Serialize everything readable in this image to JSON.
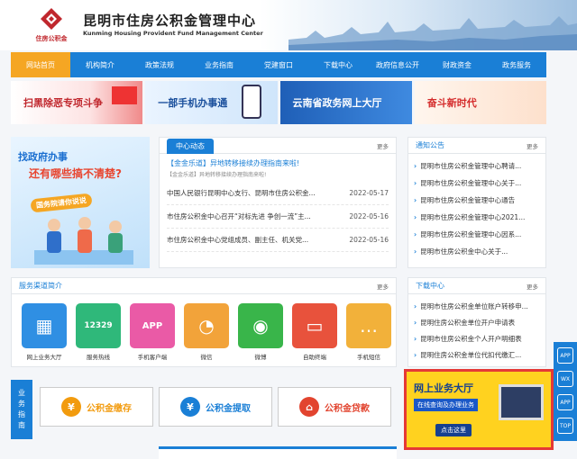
{
  "header": {
    "logo_text": "住房公积金",
    "title": "昆明市住房公积金管理中心",
    "subtitle": "Kunming Housing Provident Fund Management Center"
  },
  "nav": [
    {
      "label": "网站首页",
      "active": true
    },
    {
      "label": "机构简介"
    },
    {
      "label": "政策法规"
    },
    {
      "label": "业务指南"
    },
    {
      "label": "党建窗口"
    },
    {
      "label": "下载中心"
    },
    {
      "label": "政府信息公开"
    },
    {
      "label": "财政资金"
    },
    {
      "label": "政务服务"
    }
  ],
  "banners": [
    "扫黑除恶专项斗争",
    "一部手机办事通",
    "云南省政务网上大厅",
    "奋斗新时代"
  ],
  "promo": {
    "line1": "找政府办事",
    "line2": "还有哪些搞不清楚?",
    "line3": "国务院请你说说"
  },
  "news": {
    "tab": "中心动态",
    "more": "更多",
    "headline": "【金金乐道】异地转移接续办理指南来啦!",
    "headline_sub": "【金金乐道】异地转移接续办理指南来啦!",
    "items": [
      {
        "title": "中国人民银行昆明中心支行、昆明市住房公积金...",
        "date": "2022-05-17"
      },
      {
        "title": "市住房公积金中心召开“对标先进 争创一流”主...",
        "date": "2022-05-16"
      },
      {
        "title": "市住房公积金中心党组成员、副主任、机关党...",
        "date": "2022-05-16"
      }
    ]
  },
  "notice": {
    "title": "通知公告",
    "more": "更多",
    "items": [
      "昆明市住房公积金管理中心聘请...",
      "昆明市住房公积金管理中心关于...",
      "昆明市住房公积金管理中心通告",
      "昆明市住房公积金管理中心2021...",
      "昆明市住房公积金管理中心因系...",
      "昆明市住房公积金中心关于..."
    ]
  },
  "services": {
    "title": "服务渠道简介",
    "more": "更多",
    "items": [
      {
        "label": "网上业务大厅",
        "icon": "computer-icon",
        "color": "#2f8fe3",
        "glyph": "▦"
      },
      {
        "label": "服务热线",
        "icon": "hotline-12329-icon",
        "color": "#2fb87a",
        "glyph": "12329"
      },
      {
        "label": "手机客户端",
        "icon": "app-icon",
        "color": "#ea5aa6",
        "glyph": "APP"
      },
      {
        "label": "微信",
        "icon": "wechat-icon",
        "color": "#f2a33a",
        "glyph": "◔"
      },
      {
        "label": "微博",
        "icon": "weibo-icon",
        "color": "#39b54a",
        "glyph": "◉"
      },
      {
        "label": "自助终端",
        "icon": "terminal-icon",
        "color": "#e8523c",
        "glyph": "▭"
      },
      {
        "label": "手机短信",
        "icon": "sms-icon",
        "color": "#f2b13a",
        "glyph": "…"
      }
    ]
  },
  "download": {
    "title": "下载中心",
    "more": "更多",
    "items": [
      "昆明市住房公积金单位账户转移申...",
      "昆明住房公积金单位开户申请表",
      "昆明市住房公积金个人开户明细表",
      "昆明住房公积金单位代扣代缴汇..."
    ]
  },
  "guide": {
    "tab": "业务指南",
    "buttons": [
      {
        "label": "公积金缴存",
        "glyph": "¥"
      },
      {
        "label": "公积金提取",
        "glyph": "¥"
      },
      {
        "label": "公积金贷款",
        "glyph": "⌂"
      }
    ]
  },
  "hall": {
    "title": "网上业务大厅",
    "sub": "在线查询及办理业务",
    "button": "点击这里"
  },
  "float_bar": [
    "APP",
    "WX",
    "APP",
    "TOP"
  ]
}
